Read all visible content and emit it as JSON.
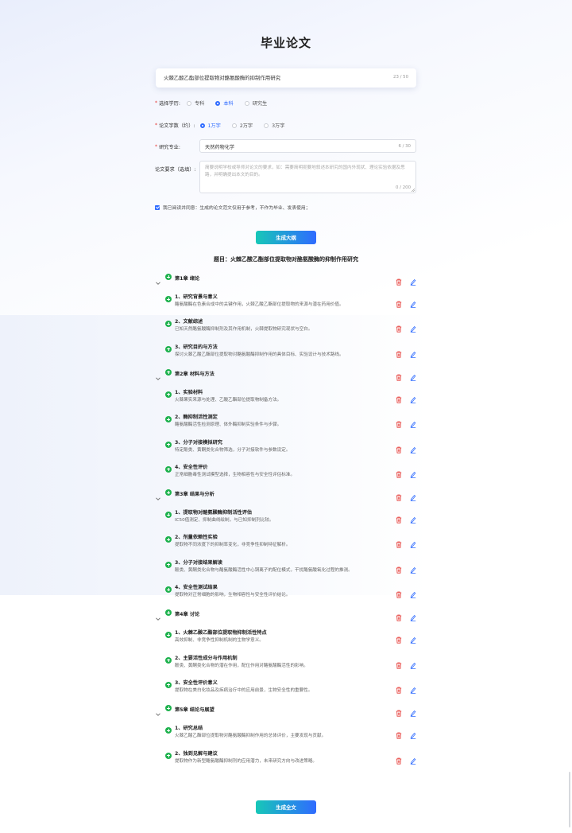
{
  "page_title": "毕业论文",
  "title_input": {
    "value": "火棘乙酸乙酯部位提取物对酪氨酸酶的抑制作用研究",
    "count": "23 / 50"
  },
  "education": {
    "label": "选择学历:",
    "options": [
      {
        "label": "专科",
        "selected": false
      },
      {
        "label": "本科",
        "selected": true
      },
      {
        "label": "研究生",
        "selected": false
      }
    ]
  },
  "word_count": {
    "label": "论文字数（约）:",
    "options": [
      {
        "label": "1万字",
        "selected": true
      },
      {
        "label": "2万字",
        "selected": false
      },
      {
        "label": "3万字",
        "selected": false
      }
    ]
  },
  "major": {
    "label": "研究专业:",
    "value": "天然药物化学",
    "count": "6 / 30"
  },
  "requirement": {
    "label": "论文要求（选填）:",
    "placeholder": "简要说明学校或导师对论文的要求，如：需要简明扼要地叙述本研究的国内外现状、理论实验依据及思路，并明确提出本文的目的。",
    "count": "0 / 200"
  },
  "agree_text": "我已阅读并同意：生成的论文范文仅用于参考，不作为毕业、发表使用；",
  "buttons": {
    "outline": "生成大纲",
    "full": "生成全文"
  },
  "colors": {
    "accent": "#2f6bff",
    "green": "#1fb24e",
    "red": "#e53935",
    "gradient_start": "#17c7b8"
  },
  "outline_title": "题目：火棘乙酸乙酯部位提取物对酪氨酸酶的抑制作用研究",
  "chapters": [
    {
      "label": "第1章 绪论",
      "sections": [
        {
          "title": "1、研究背景与意义",
          "desc": "酪氨酸酶在色素合成中的关键作用，火棘乙酸乙酯部位提取物的来源与潜在药用价值。"
        },
        {
          "title": "2、文献综述",
          "desc": "已知天然酪氨酸酶抑制剂及其作用机制，火棘提取物研究现状与空白。"
        },
        {
          "title": "3、研究目的与方法",
          "desc": "探讨火棘乙酸乙酯部位提取物对酪氨酸酶抑制作用的具体目标、实验设计与技术路线。"
        }
      ]
    },
    {
      "label": "第2章 材料与方法",
      "sections": [
        {
          "title": "1、实验材料",
          "desc": "火棘果实来源与处理、乙酸乙酯部位提取物制备方法。"
        },
        {
          "title": "2、酶抑制活性测定",
          "desc": "酪氨酸酶活性检测原理、体外酶抑制实验条件与步骤。"
        },
        {
          "title": "3、分子对接模拟研究",
          "desc": "特定酚类、黄酮类化合物筛选，分子对接软件与参数设定。"
        },
        {
          "title": "4、安全性评价",
          "desc": "正常细胞毒性测试模型选择，生物相容性与安全性评估标准。"
        }
      ]
    },
    {
      "label": "第3章 结果与分析",
      "sections": [
        {
          "title": "1、提取物对酪氨酸酶抑制活性评估",
          "desc": "IC50值测定、抑制曲线绘制，与已知抑制剂比较。"
        },
        {
          "title": "2、剂量依赖性实验",
          "desc": "提取物不同浓度下的抑制率变化，非竞争性抑制特征解析。"
        },
        {
          "title": "3、分子对接结果解读",
          "desc": "酚类、黄酮类化合物与酪氨酸酶活性中心铜离子的配位模式，干扰酪氨酸氧化过程的推测。"
        },
        {
          "title": "4、安全性测试结果",
          "desc": "提取物对正常细胞的影响，生物相容性与安全性评价结论。"
        }
      ]
    },
    {
      "label": "第4章 讨论",
      "sections": [
        {
          "title": "1、火棘乙酸乙酯部位提取物抑制活性特点",
          "desc": "高效抑制、非竞争性抑制机制的生物学意义。"
        },
        {
          "title": "2、主要活性成分与作用机制",
          "desc": "酚类、黄酮类化合物的潜在作用，配位作用对酪氨酸酶活性的影响。"
        },
        {
          "title": "3、安全性评价意义",
          "desc": "提取物在美白化妆品及疾病治疗中的应用前景，生物安全性的重要性。"
        }
      ]
    },
    {
      "label": "第5章 结论与展望",
      "sections": [
        {
          "title": "1、研究总结",
          "desc": "火棘乙酸乙酯部位提取物对酪氨酸酶抑制作用的总体评价，主要发现与贡献。"
        },
        {
          "title": "2、独到见解与建议",
          "desc": "提取物作为新型酪氨酸酶抑制剂的应用潜力，未来研究方向与改进策略。"
        }
      ]
    }
  ]
}
